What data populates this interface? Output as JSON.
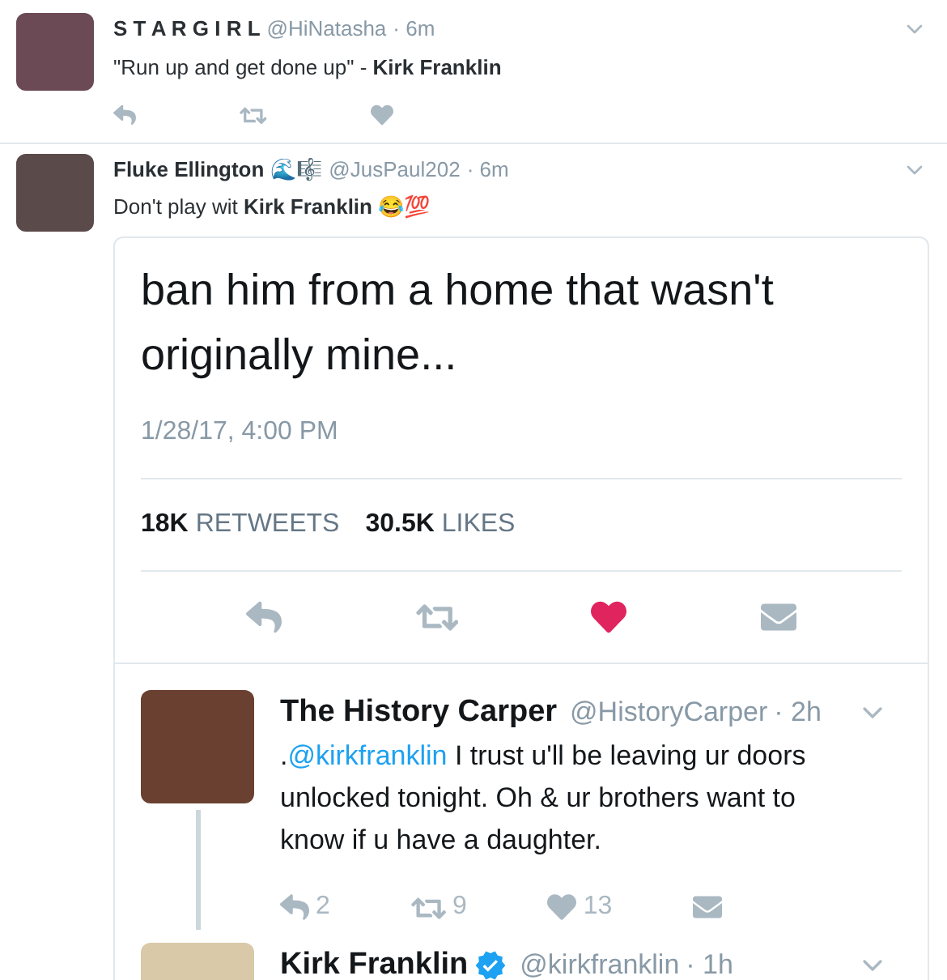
{
  "tweets": [
    {
      "name": "S T A R G I R L",
      "handle": "@HiNatasha",
      "time": "· 6m",
      "text": "\"Run up and get done up\" - **Kirk Franklin**",
      "actions": [
        {
          "kind": "reply",
          "liked": false
        },
        {
          "kind": "retweet",
          "liked": false
        },
        {
          "kind": "like",
          "liked": false
        }
      ]
    },
    {
      "name": "Fluke Ellington",
      "name_emoji": "🌊🎼",
      "handle": "@JusPaul202",
      "time": "· 6m",
      "text": "Don't play wit **Kirk Franklin** 😂💯",
      "card": {
        "text": "ban him from a home that wasn't originally mine...",
        "date": "1/28/17, 4:00 PM",
        "stats": [
          {
            "count": "18K",
            "label": "RETWEETS"
          },
          {
            "count": "30.5K",
            "label": "LIKES"
          }
        ],
        "actions": [
          {
            "kind": "reply",
            "liked": false
          },
          {
            "kind": "retweet",
            "liked": false
          },
          {
            "kind": "like",
            "liked": true
          },
          {
            "kind": "message",
            "liked": false
          }
        ],
        "replies": [
          {
            "name": "The History Carper",
            "verified": false,
            "handle": "@HistoryCarper",
            "time": "· 2h",
            "prefix": ".",
            "mention": "@kirkfranklin",
            "text": " I trust u'll be leaving ur doors unlocked tonight. Oh & ur brothers want to know if u have a daughter.",
            "actions": [
              {
                "kind": "reply",
                "count": "2"
              },
              {
                "kind": "retweet",
                "count": "9"
              },
              {
                "kind": "like",
                "count": "13"
              },
              {
                "kind": "message"
              }
            ]
          },
          {
            "name": "Kirk Franklin",
            "verified": true,
            "handle": "@kirkfranklin",
            "time": "· 1h"
          }
        ]
      }
    }
  ]
}
